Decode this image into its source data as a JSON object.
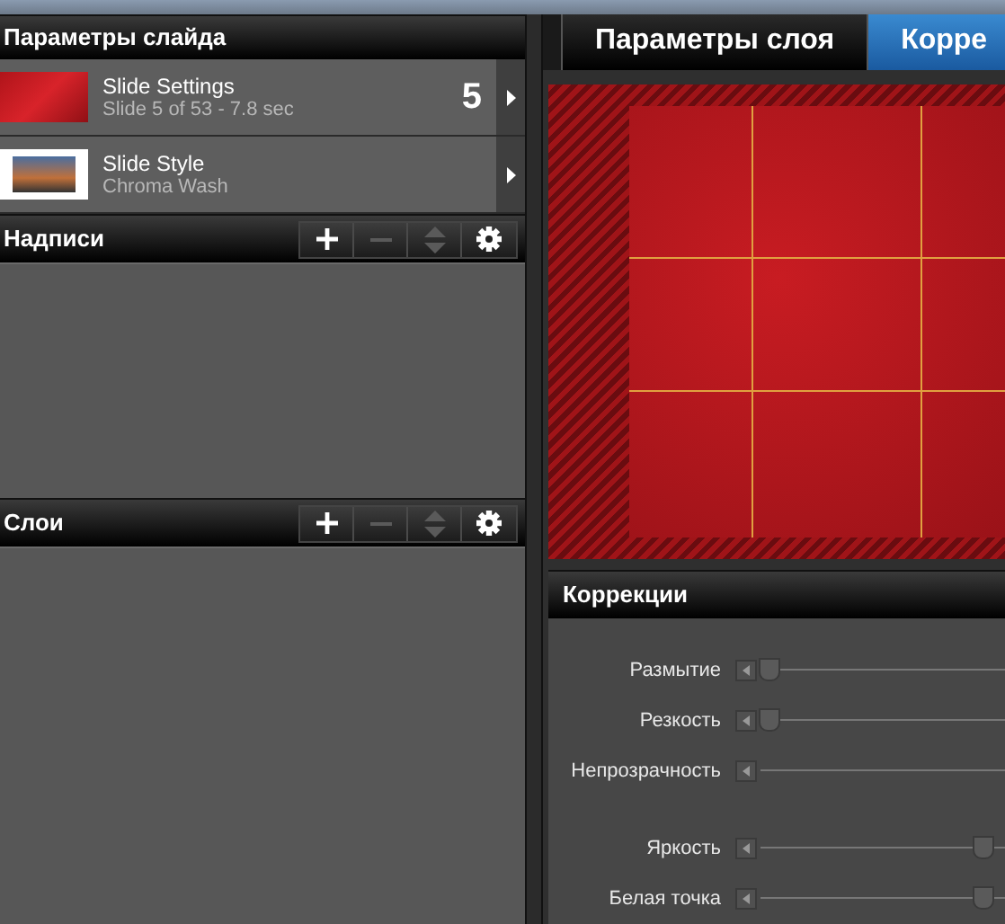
{
  "slide_panel": {
    "title": "Параметры слайда",
    "items": [
      {
        "kind": "slide",
        "title": "Slide Settings",
        "subtitle": "Slide 5 of 53 - 7.8 sec",
        "number": "5"
      },
      {
        "kind": "style",
        "title": "Slide Style",
        "subtitle": "Chroma Wash"
      }
    ]
  },
  "sections": [
    {
      "title": "Надписи",
      "tools": [
        {
          "kind": "add",
          "disabled": false
        },
        {
          "kind": "remove",
          "disabled": true
        },
        {
          "kind": "order",
          "disabled": true
        },
        {
          "kind": "settings",
          "disabled": false
        }
      ]
    },
    {
      "title": "Слои",
      "tools": [
        {
          "kind": "add",
          "disabled": false
        },
        {
          "kind": "remove",
          "disabled": true
        },
        {
          "kind": "order",
          "disabled": true
        },
        {
          "kind": "settings",
          "disabled": false
        }
      ]
    }
  ],
  "tabs": [
    {
      "label": "Параметры слоя",
      "selected": false
    },
    {
      "label": "Корре",
      "selected": true
    }
  ],
  "corrections": {
    "title": "Коррекции",
    "sliders": [
      {
        "label": "Размытие",
        "level": 0.0
      },
      {
        "label": "Резкость",
        "level": 0.0
      },
      {
        "label": "Непрозрачность"
      },
      {
        "label": "Яркость",
        "level": 0.5,
        "gap_before": true
      },
      {
        "label": "Белая точка",
        "level": 0.5
      }
    ]
  }
}
